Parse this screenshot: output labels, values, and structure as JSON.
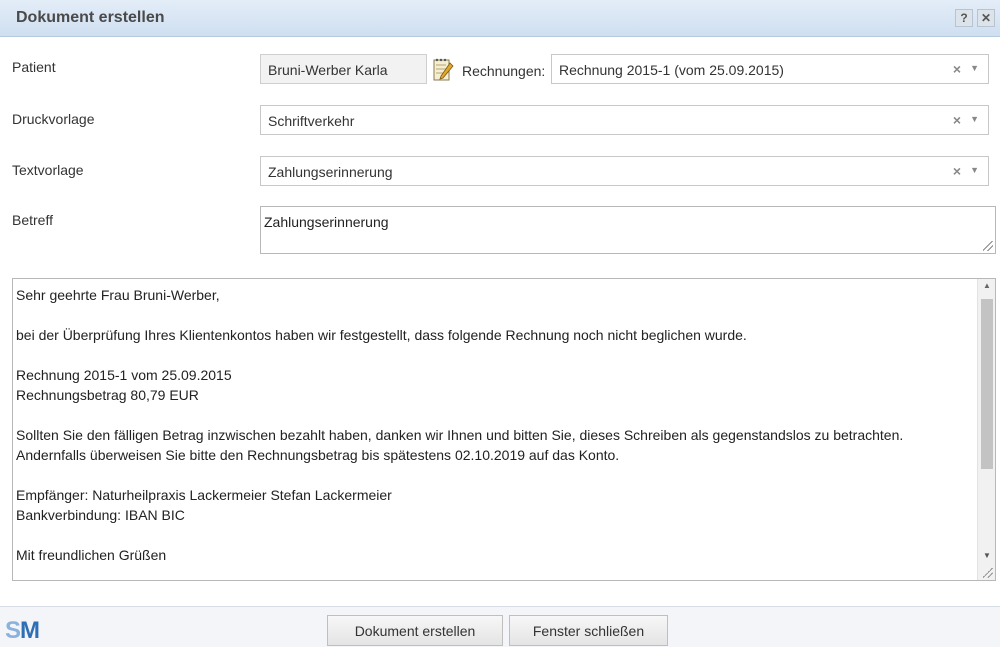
{
  "window": {
    "title": "Dokument erstellen",
    "help_label": "?",
    "close_label": "✕"
  },
  "form": {
    "patient_label": "Patient",
    "patient_value": "Bruni-Werber Karla",
    "rechnungen_label": "Rechnungen:",
    "rechnungen_value": "Rechnung 2015-1 (vom 25.09.2015)",
    "druckvorlage_label": "Druckvorlage",
    "druckvorlage_value": "Schriftverkehr",
    "textvorlage_label": "Textvorlage",
    "textvorlage_value": "Zahlungserinnerung",
    "betreff_label": "Betreff",
    "betreff_value": "Zahlungserinnerung",
    "clear_symbol": "×",
    "caret_symbol": "▼"
  },
  "body": {
    "lines": [
      "Sehr geehrte Frau Bruni-Werber,",
      "",
      "bei der Überprüfung Ihres Klientenkontos haben wir festgestellt, dass folgende Rechnung noch nicht beglichen wurde.",
      "",
      "Rechnung 2015-1 vom 25.09.2015",
      "Rechnungsbetrag 80,79 EUR",
      "",
      "Sollten Sie den fälligen Betrag inzwischen bezahlt haben, danken wir Ihnen und bitten Sie, dieses Schreiben als gegenstandslos zu betrachten.",
      "Andernfalls überweisen Sie bitte den Rechnungsbetrag bis spätestens 02.10.2019 auf das Konto.",
      "",
      "Empfänger: Naturheilpraxis Lackermeier Stefan Lackermeier",
      "Bankverbindung:  IBAN  BIC",
      "",
      "Mit freundlichen Grüßen"
    ]
  },
  "footer": {
    "logo_s": "S",
    "logo_m": "M",
    "create_button": "Dokument erstellen",
    "close_button": "Fenster schließen"
  },
  "colors": {
    "title_bar": "#cfdff0",
    "logo_light": "#8ab2dc",
    "logo_dark": "#2f6fb5"
  },
  "icons": {
    "patient_edit": "notepad-pencil-icon"
  }
}
